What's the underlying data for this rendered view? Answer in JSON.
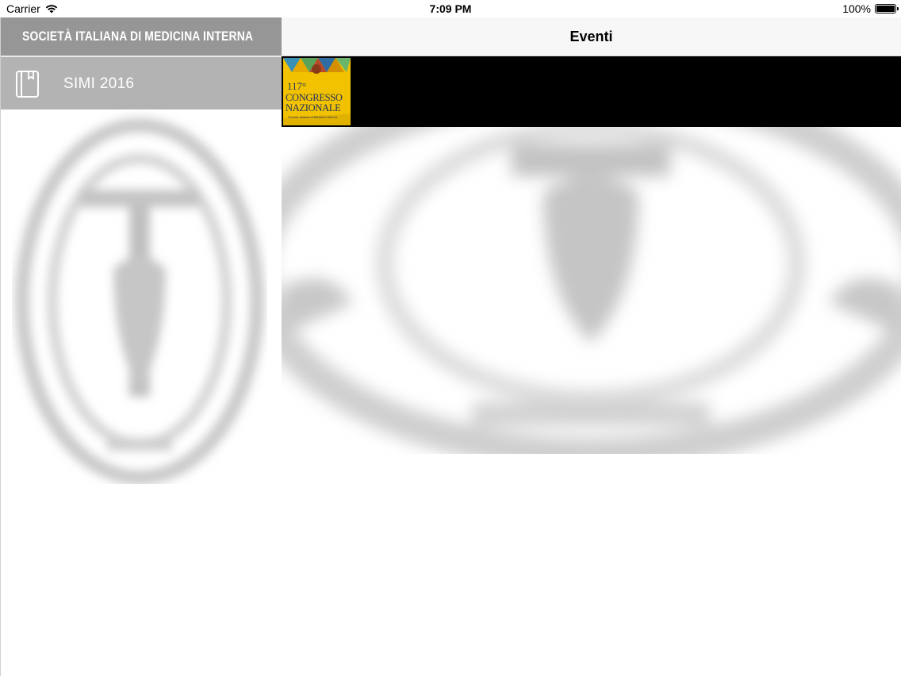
{
  "status_bar": {
    "carrier": "Carrier",
    "time": "7:09 PM",
    "battery": "100%"
  },
  "sidebar": {
    "header": "SOCIETÀ ITALIANA DI MEDICINA INTERNA",
    "items": [
      {
        "label": "SIMI 2016",
        "icon": "book-icon"
      }
    ]
  },
  "main": {
    "title": "Eventi",
    "events": [
      {
        "poster_line1": "117°",
        "poster_line2": "CONGRESSO",
        "poster_line3": "NAZIONALE",
        "poster_subtitle": "Società Italiana di Medicina Interna"
      }
    ]
  },
  "colors": {
    "sidebar_header_bg": "#969696",
    "sidebar_item_bg": "#b3b3b3",
    "event_row_bg": "#000000",
    "poster_bg": "#f2c200",
    "poster_text": "#1c2f5e"
  }
}
